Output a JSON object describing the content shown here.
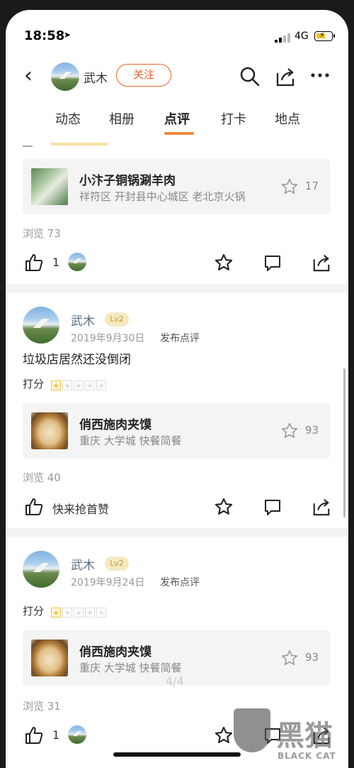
{
  "status_bar": {
    "time": "18:58",
    "network": "4G"
  },
  "header": {
    "user_name": "武木",
    "follow_label": "关注"
  },
  "tabs": [
    {
      "label": "动态"
    },
    {
      "label": "相册"
    },
    {
      "label": "点评"
    },
    {
      "label": "打卡"
    },
    {
      "label": "地点"
    }
  ],
  "posts": [
    {
      "shop": {
        "name": "小汴子铜锅涮羊肉",
        "sub": "祥符区 开封县中心城区 老北京火锅",
        "stars": "17"
      },
      "views": "浏览 73",
      "like_count": "1"
    },
    {
      "user": "武木",
      "level": "Lv2",
      "date": "2019年9月30日",
      "action": "发布点评",
      "text": "垃圾店居然还没倒闭",
      "rating_label": "打分",
      "rating": 1,
      "shop": {
        "name": "俏西施肉夹馍",
        "sub": "重庆 大学城 快餐简餐",
        "stars": "93"
      },
      "views": "浏览 40",
      "first_like": "快来抢首赞"
    },
    {
      "user": "武木",
      "level": "Lv2",
      "date": "2019年9月24日",
      "action": "发布点评",
      "rating_label": "打分",
      "rating": 1,
      "shop": {
        "name": "俏西施肉夹馍",
        "sub": "重庆 大学城 快餐简餐",
        "stars": "93"
      },
      "views": "浏览 31",
      "like_count": "1"
    }
  ],
  "page_indicator": "4/4",
  "watermark": {
    "cn": "黑猫",
    "en": "BLACK CAT"
  },
  "colors": {
    "accent": "#e8632c",
    "tab_underline": "#f08a3b",
    "star": "#f5c23a"
  }
}
